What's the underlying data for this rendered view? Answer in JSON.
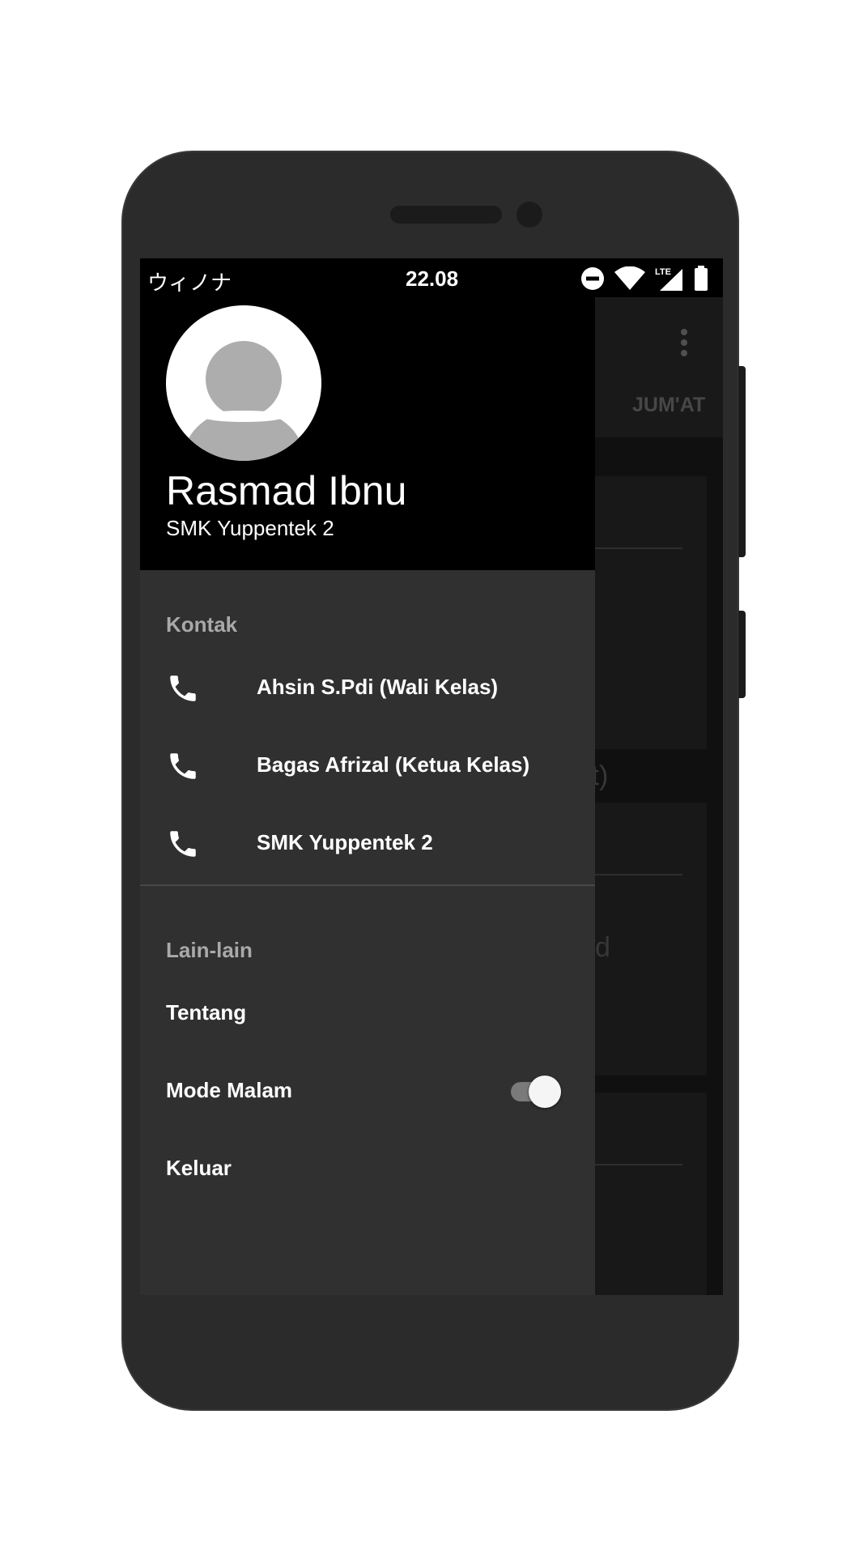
{
  "status_bar": {
    "carrier": "ウィノナ",
    "time": "22.08",
    "icons": [
      "do-not-disturb-icon",
      "wifi-icon",
      "lte-signal-icon",
      "battery-icon"
    ],
    "network_label": "LTE"
  },
  "background_app": {
    "tab_visible": "JUM'AT",
    "fragment_1": "it)",
    "fragment_2": "d"
  },
  "drawer": {
    "user_name": "Rasmad Ibnu",
    "user_school": "SMK Yuppentek 2",
    "contacts_title": "Kontak",
    "contacts": [
      {
        "label": "Ahsin S.Pdi (Wali Kelas)",
        "icon": "phone-icon"
      },
      {
        "label": "Bagas Afrizal (Ketua Kelas)",
        "icon": "phone-icon"
      },
      {
        "label": "SMK Yuppentek 2",
        "icon": "phone-icon"
      }
    ],
    "others_title": "Lain-lain",
    "others": {
      "about": "Tentang",
      "night_mode": "Mode Malam",
      "night_mode_enabled": true,
      "logout": "Keluar"
    }
  },
  "colors": {
    "drawer_bg": "#303030",
    "header_bg": "#000000",
    "section_title": "#a9a9a9",
    "text": "#ffffff"
  }
}
